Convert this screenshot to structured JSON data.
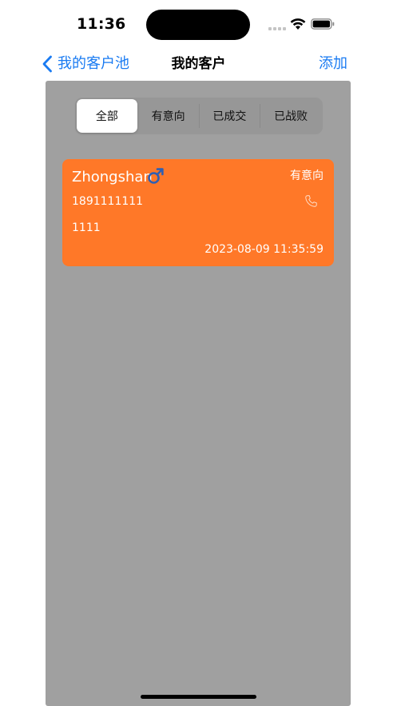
{
  "status_bar": {
    "time": "11:36"
  },
  "nav": {
    "back_label": "我的客户池",
    "title": "我的客户",
    "add_label": "添加"
  },
  "segments": [
    {
      "label": "全部",
      "selected": true
    },
    {
      "label": "有意向",
      "selected": false
    },
    {
      "label": "已成交",
      "selected": false
    },
    {
      "label": "已战败",
      "selected": false
    }
  ],
  "customers": [
    {
      "name": "Zhongshan",
      "gender_icon": "male-symbol-icon",
      "status": "有意向",
      "phone": "1891111111",
      "note": "1111",
      "time": "2023-08-09 11:35:59"
    }
  ],
  "colors": {
    "accent": "#1a7bf2",
    "card": "#ff7828",
    "panel": "#a0a0a0",
    "gender_icon": "#2f5fb3"
  }
}
